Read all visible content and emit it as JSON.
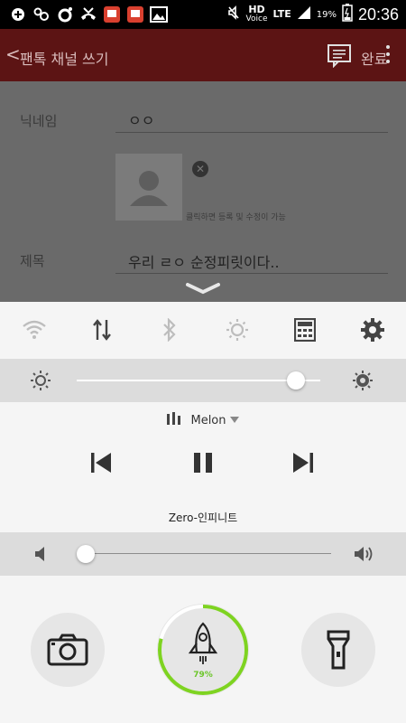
{
  "status_bar": {
    "time": "20:36",
    "battery": "19%",
    "network": "LTE",
    "hd_label": "HD",
    "voice_label": "Voice",
    "notification_icons": [
      "plus-icon",
      "nate-icon",
      "ring-icon",
      "missed-call-icon",
      "app-badge-icon",
      "app-badge-icon",
      "gallery-icon"
    ]
  },
  "app_bar": {
    "back_glyph": "<",
    "title": "팬톡 채널 쓰기",
    "done_label": "완료"
  },
  "form": {
    "nickname_label": "닉네임",
    "nickname_value": "ㅇㅇ",
    "image_caption": "클릭하면 등록 및 수정이 가능",
    "title_label": "제목",
    "title_value": "우리 ㄹㅇ 순정피릿이다.."
  },
  "quick_panel": {
    "toggles": [
      "wifi-icon",
      "data-icon",
      "bluetooth-icon",
      "auto-brightness-icon",
      "calculator-icon",
      "settings-icon"
    ],
    "brightness_level": 0.9,
    "player": {
      "app_name": "Melon",
      "song_title": "Zero-인피니트"
    },
    "volume_level": 0.0,
    "boost_percent": "79%",
    "boost_fraction": 0.79
  },
  "colors": {
    "accent_green": "#7ed321",
    "app_bar_red": "#5c1414"
  }
}
